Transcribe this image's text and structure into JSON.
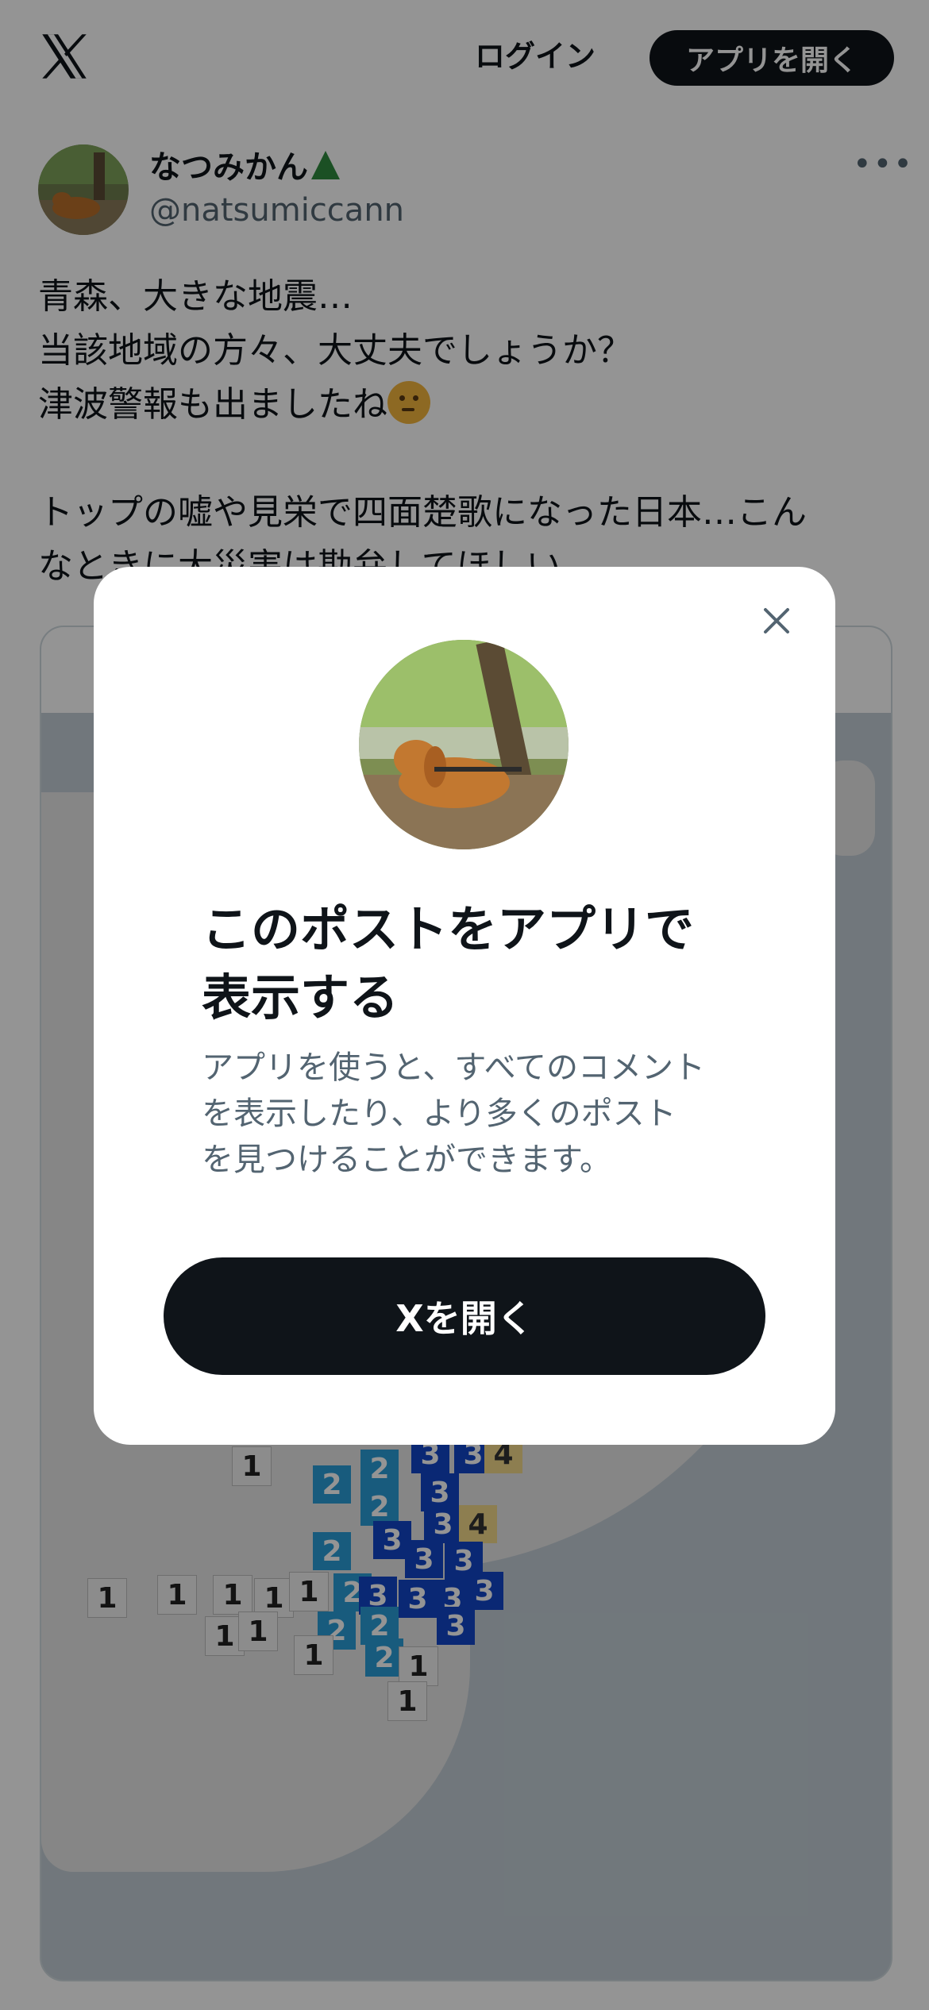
{
  "header": {
    "logo_icon": "x-logo-icon",
    "login_label": "ログイン",
    "open_app_label": "アプリを開く"
  },
  "post": {
    "display_name": "なつみかん",
    "handle": "@natsumiccann",
    "more_label": "•••",
    "text_lines": [
      "青森、大きな地震…",
      "当該地域の方々、大丈夫でしょうか？",
      "津波警報も出ましたね",
      "",
      "トップの嘘や見栄で四面楚歌になった日本…こん",
      "なときに大災害は勘弁してほしい"
    ]
  },
  "map": {
    "intensity_labels": [
      "1",
      "1",
      "1",
      "1",
      "1",
      "1",
      "1",
      "1",
      "1",
      "1",
      "1",
      "2",
      "2",
      "2",
      "2",
      "2",
      "2",
      "2",
      "2",
      "3",
      "3",
      "3",
      "3",
      "3",
      "3",
      "3",
      "3",
      "3",
      "3",
      "3",
      "4",
      "4"
    ],
    "colors": {
      "int1": "#f2f2f2",
      "int2": "#2a9ed8",
      "int3": "#1246c8",
      "int4": "#f3d98a"
    }
  },
  "modal": {
    "close_icon": "close-icon",
    "title_lines": [
      "このポストをアプリで",
      "表示する"
    ],
    "description_lines": [
      "アプリを使うと、すべてのコメント",
      "を表示したり、より多くのポスト",
      "を見つけることができます。"
    ],
    "open_button_label": "Xを開く"
  }
}
